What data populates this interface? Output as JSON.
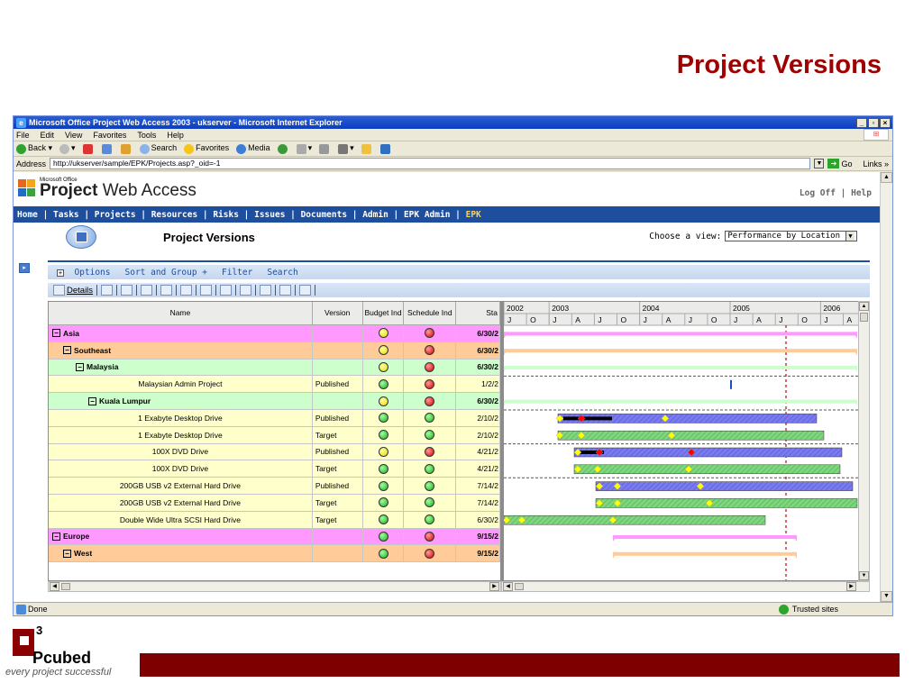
{
  "slide": {
    "title": "Project Versions"
  },
  "browser": {
    "window_title": "Microsoft Office Project Web Access 2003 - ukserver - Microsoft Internet Explorer",
    "menu": [
      "File",
      "Edit",
      "View",
      "Favorites",
      "Tools",
      "Help"
    ],
    "toolbar": {
      "back": "Back",
      "search": "Search",
      "favorites": "Favorites",
      "media": "Media"
    },
    "address_label": "Address",
    "address_url": "http://ukserver/sample/EPK/Projects.asp?_oid=-1",
    "go_label": "Go",
    "links_label": "Links",
    "status_text": "Done",
    "zone_text": "Trusted sites"
  },
  "pwa": {
    "brand_small": "Microsoft Office",
    "brand_project": "Project",
    "brand_rest": " Web Access",
    "logoff": "Log Off | Help",
    "nav_main": "Home | Tasks | Projects | Resources | Risks | Issues | Documents | Admin | EPK Admin | ",
    "nav_current": "EPK",
    "page_title": "Project Versions",
    "choose_view_label": "Choose a view:",
    "choose_view_value": "Performance by Location",
    "options": {
      "options": "Options",
      "sort": "Sort and Group +",
      "filter": "Filter",
      "search": "Search"
    },
    "details_label": "Details"
  },
  "grid": {
    "headers": {
      "name": "Name",
      "version": "Version",
      "budget": "Budget Ind",
      "schedule": "Schedule Ind",
      "start": "Sta"
    },
    "rows": [
      {
        "name": "Asia",
        "level": "region",
        "version": "",
        "budget": "yellow",
        "schedule": "red",
        "start": "6/30/2"
      },
      {
        "name": "Southeast",
        "level": "sub",
        "version": "",
        "budget": "yellow",
        "schedule": "red",
        "start": "6/30/2"
      },
      {
        "name": "Malaysia",
        "level": "country",
        "version": "",
        "budget": "yellow",
        "schedule": "red",
        "start": "6/30/2"
      },
      {
        "name": "Malaysian Admin Project",
        "level": "proj",
        "version": "Published",
        "budget": "green",
        "schedule": "red",
        "start": "1/2/2"
      },
      {
        "name": "Kuala Lumpur",
        "level": "city",
        "version": "",
        "budget": "yellow",
        "schedule": "red",
        "start": "6/30/2"
      },
      {
        "name": "1 Exabyte Desktop Drive",
        "level": "proj",
        "version": "Published",
        "budget": "green",
        "schedule": "green",
        "start": "2/10/2"
      },
      {
        "name": "1 Exabyte Desktop Drive",
        "level": "proj",
        "version": "Target",
        "budget": "green",
        "schedule": "green",
        "start": "2/10/2"
      },
      {
        "name": "100X DVD Drive",
        "level": "proj",
        "version": "Published",
        "budget": "yellow",
        "schedule": "red",
        "start": "4/21/2"
      },
      {
        "name": "100X DVD Drive",
        "level": "proj",
        "version": "Target",
        "budget": "green",
        "schedule": "green",
        "start": "4/21/2"
      },
      {
        "name": "200GB USB v2 External Hard Drive",
        "level": "proj",
        "version": "Published",
        "budget": "green",
        "schedule": "green",
        "start": "7/14/2"
      },
      {
        "name": "200GB USB v2 External Hard Drive",
        "level": "proj",
        "version": "Target",
        "budget": "green",
        "schedule": "green",
        "start": "7/14/2"
      },
      {
        "name": "Double Wide Ultra SCSI Hard Drive",
        "level": "proj",
        "version": "Target",
        "budget": "green",
        "schedule": "green",
        "start": "6/30/2"
      },
      {
        "name": "Europe",
        "level": "region",
        "version": "",
        "budget": "green",
        "schedule": "red",
        "start": "9/15/2"
      },
      {
        "name": "West",
        "level": "sub",
        "version": "",
        "budget": "green",
        "schedule": "red",
        "start": "9/15/2"
      }
    ]
  },
  "gantt": {
    "years": [
      "2002",
      "2003",
      "2004",
      "2005",
      "2006"
    ],
    "quarters": [
      "J",
      "O",
      "J",
      "A",
      "J",
      "O",
      "J",
      "A",
      "J",
      "O",
      "J",
      "A",
      "J",
      "O",
      "J",
      "A"
    ]
  },
  "footer": {
    "brand": "Pcubed",
    "tagline": "every project successful",
    "superscript": "3"
  },
  "colors": {
    "slide_title": "#a00000",
    "nav_bg": "#1d4f9e",
    "footer_bar": "#7f0000"
  }
}
